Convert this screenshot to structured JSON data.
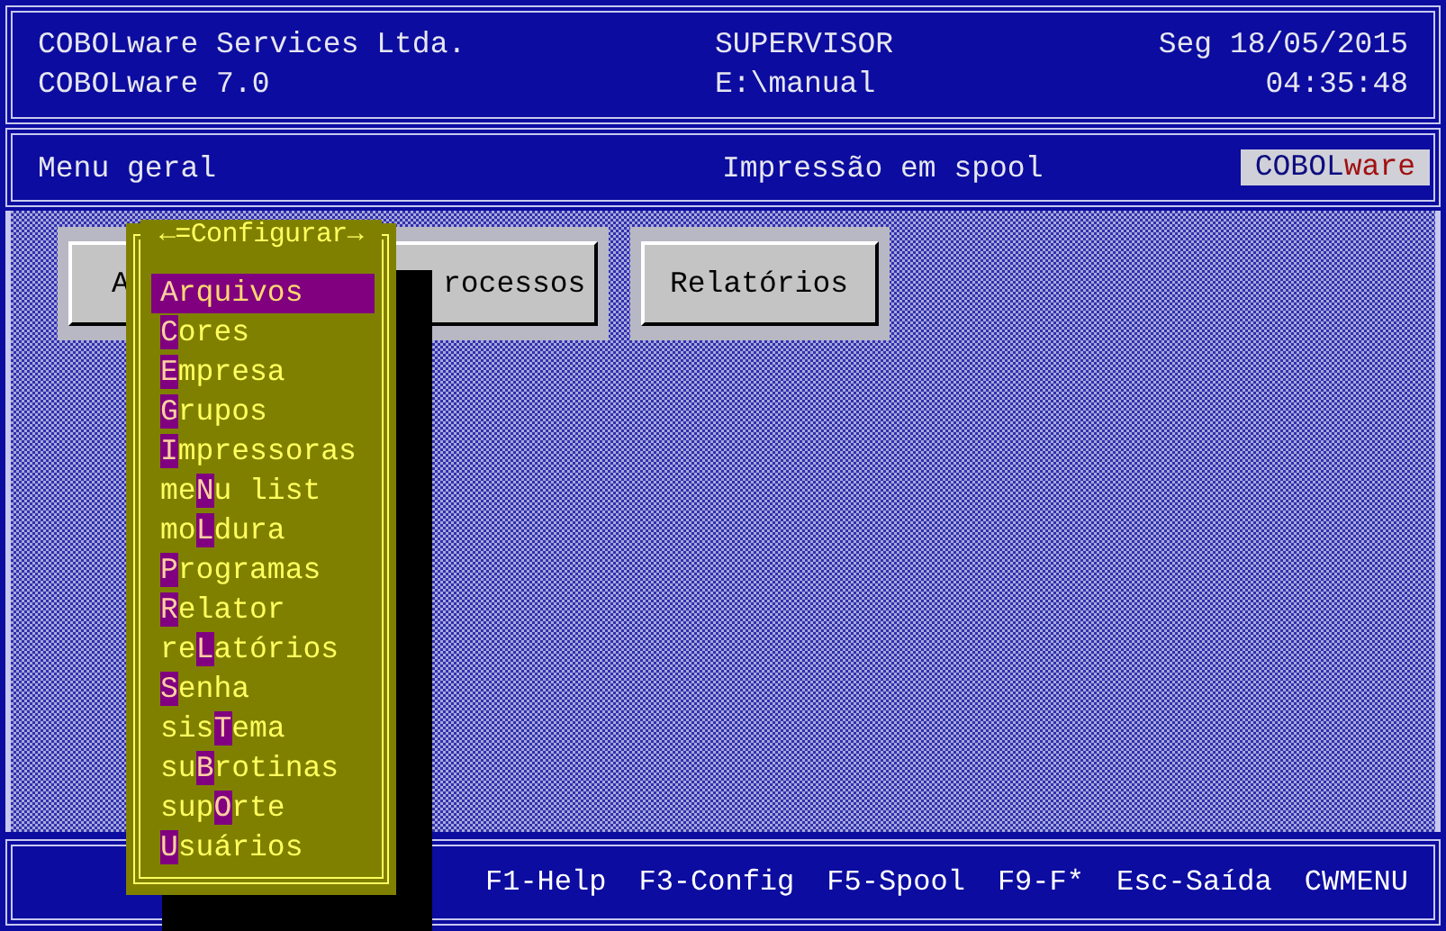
{
  "header": {
    "company": "COBOLware Services Ltda.",
    "product": "COBOLware 7.0",
    "user": "SUPERVISOR",
    "path": "E:\\manual",
    "date": "Seg 18/05/2015",
    "time": "04:35:48"
  },
  "subheader": {
    "menu_title": "Menu geral",
    "status": "Impressão em spool",
    "badge": {
      "text": "COBOL",
      "accent": "ware"
    }
  },
  "buttons": [
    {
      "label": "A"
    },
    {
      "label": "rocessos"
    },
    {
      "label": "Relatórios"
    }
  ],
  "menu": {
    "title": "←=Configurar→",
    "items": [
      {
        "key": "A",
        "post": "rquivos",
        "selected": true
      },
      {
        "key": "C",
        "post": "ores",
        "selected": false
      },
      {
        "key": "E",
        "post": "mpresa",
        "selected": false
      },
      {
        "key": "G",
        "post": "rupos",
        "selected": false
      },
      {
        "key": "I",
        "post": "mpressoras",
        "selected": false
      },
      {
        "pre": "me",
        "key": "N",
        "post": "u list",
        "selected": false
      },
      {
        "pre": "mo",
        "key": "L",
        "post": "dura",
        "selected": false
      },
      {
        "key": "P",
        "post": "rogramas",
        "selected": false
      },
      {
        "key": "R",
        "post": "elator",
        "selected": false
      },
      {
        "pre": "re",
        "key": "L",
        "post": "atórios",
        "selected": false
      },
      {
        "key": "S",
        "post": "enha",
        "selected": false
      },
      {
        "pre": "sis",
        "key": "T",
        "post": "ema",
        "selected": false
      },
      {
        "pre": "su",
        "key": "B",
        "post": "rotinas",
        "selected": false
      },
      {
        "pre": "sup",
        "key": "O",
        "post": "rte",
        "selected": false
      },
      {
        "key": "U",
        "post": "suários",
        "selected": false
      }
    ]
  },
  "footer": [
    "F1-Help",
    "F3-Config",
    "F5-Spool",
    "F9-F*",
    "Esc-Saída",
    "CWMENU"
  ]
}
